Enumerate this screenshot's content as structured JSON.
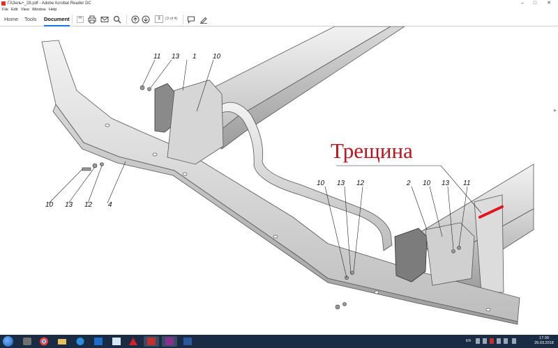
{
  "window": {
    "title": "ГАЗель+_28.pdf - Adobe Acrobat Reader DC",
    "minimize_glyph": "–",
    "maximize_glyph": "□",
    "close_glyph": "✕"
  },
  "menu": [
    "File",
    "Edit",
    "View",
    "Window",
    "Help"
  ],
  "toolbar": {
    "tabs": [
      "Home",
      "Tools",
      "Document"
    ],
    "active_tab": "Document",
    "page_number": "3",
    "page_of": "(3 of 4)",
    "icons": [
      "save-icon",
      "print-icon",
      "email-icon",
      "search-icon",
      "page-up-icon",
      "page-down-icon",
      "comment-icon",
      "sign-icon"
    ]
  },
  "document": {
    "crack_label": "Трещина",
    "crack_color": "#e0161c",
    "callouts_left_top": [
      "11",
      "13",
      "1",
      "10"
    ],
    "callouts_left_bottom": [
      "10",
      "13",
      "12",
      "4"
    ],
    "callouts_right": [
      "10",
      "13",
      "12",
      "2",
      "10",
      "13",
      "11"
    ]
  },
  "taskbar": {
    "apps": [
      "explorer-icon",
      "chrome-icon",
      "folder-icon",
      "ie-icon",
      "outlook-icon",
      "excel-icon",
      "acrobat-icon",
      "paint-icon",
      "word-icon",
      "app-icon",
      "word-doc-icon"
    ],
    "tray": {
      "lang": "EN",
      "time": "17:39",
      "date": "26.03.2018"
    }
  },
  "colors": {
    "accent": "#1473e6",
    "taskbar_bg": "#1a2b44",
    "crack": "#c4121a"
  }
}
